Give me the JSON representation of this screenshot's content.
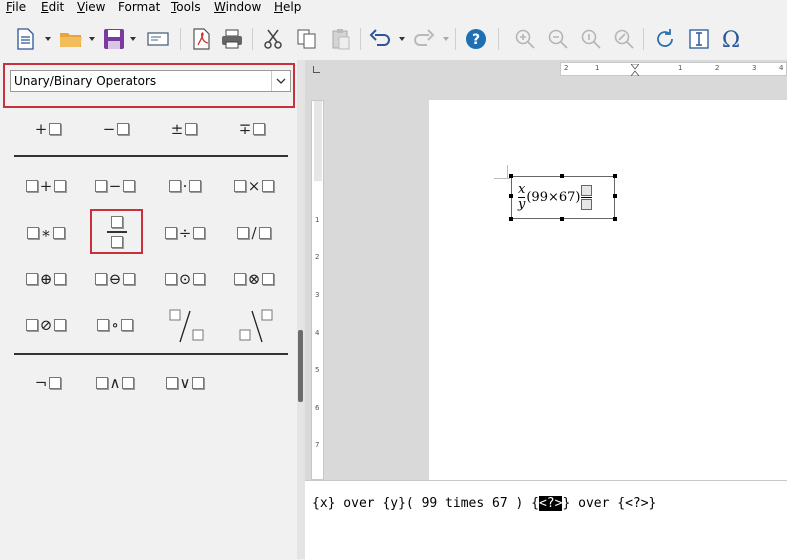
{
  "menu": {
    "items": [
      {
        "label": "File",
        "underline": "F",
        "rest": "ile"
      },
      {
        "label": "Edit",
        "underline": "E",
        "rest": "dit"
      },
      {
        "label": "View",
        "underline": "V",
        "rest": "iew"
      },
      {
        "label": "Format",
        "underline": "",
        "rest": "Format"
      },
      {
        "label": "Tools",
        "underline": "T",
        "rest": "ools"
      },
      {
        "label": "Window",
        "underline": "W",
        "rest": "indow"
      },
      {
        "label": "Help",
        "underline": "H",
        "rest": "elp"
      }
    ]
  },
  "elements_panel": {
    "category": "Unary/Binary Operators",
    "symbols": [
      {
        "op": "+"
      },
      {
        "op": "−"
      },
      {
        "op": "±"
      },
      {
        "op": "∓"
      },
      {
        "op": "+"
      },
      {
        "op": "−"
      },
      {
        "op": "·"
      },
      {
        "op": "×"
      },
      {
        "op": "∗"
      },
      {
        "op": "÷"
      },
      {
        "op": "/"
      },
      {
        "op": "⊕"
      },
      {
        "op": "⊖"
      },
      {
        "op": "⊙"
      },
      {
        "op": "⊗"
      },
      {
        "op": "⊘"
      },
      {
        "op": "∘"
      },
      {
        "op": "¬"
      },
      {
        "op": "∧"
      },
      {
        "op": "∨"
      }
    ]
  },
  "ruler": {
    "h_numbers": [
      "2",
      "1",
      "1",
      "2",
      "3",
      "4"
    ],
    "v_numbers": [
      "1",
      "2",
      "3",
      "4",
      "5",
      "6",
      "7"
    ]
  },
  "formula": {
    "num": "x",
    "den": "y",
    "middle": "(99×67)"
  },
  "command": {
    "prefix": "{x} over {y}( 99 times 67 ) {",
    "placeholder": "<?>",
    "suffix": "} over {<?>}"
  },
  "colors": {
    "highlight": "#c8303b",
    "help_blue": "#1f6fb2"
  }
}
